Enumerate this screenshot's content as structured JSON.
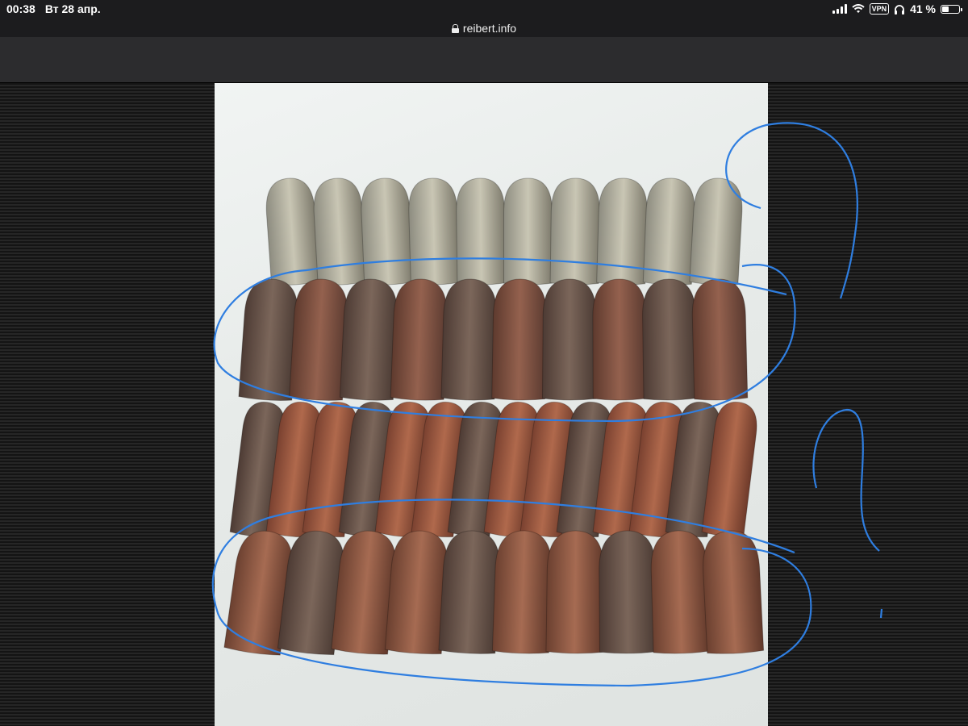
{
  "status_bar": {
    "time": "00:38",
    "date": "Вт 28 апр.",
    "vpn_label": "VPN",
    "battery": "41 %",
    "battery_level": 0.41
  },
  "browser": {
    "url": "reibert.info"
  },
  "photo": {
    "subject": "bullets",
    "rows": 4
  },
  "icons": {
    "lock": "lock-icon",
    "wifi": "wifi-icon",
    "signal": "cellular-signal-icon",
    "headphones": "headphones-icon",
    "battery": "battery-icon"
  },
  "colors": {
    "annotation": "#2f7ee0",
    "statusbar_bg": "#1c1c1e",
    "toolbar_bg": "#2c2c2e"
  }
}
